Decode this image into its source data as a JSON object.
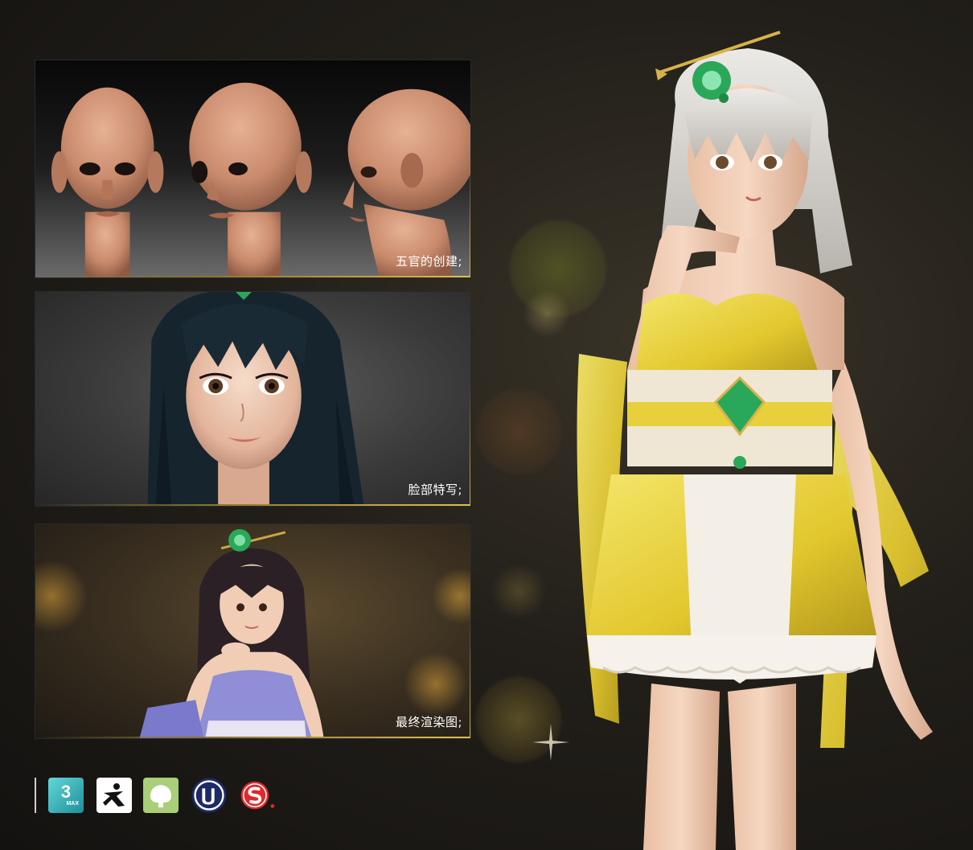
{
  "panels": [
    {
      "caption": "五官的创建;",
      "subject": "head-sculpt-models"
    },
    {
      "caption": "脸部特写;",
      "subject": "face-closeup"
    },
    {
      "caption": "最终渲染图;",
      "subject": "final-render"
    }
  ],
  "software": [
    {
      "name": "3ds-max-icon",
      "number": "3",
      "text": "MAX"
    },
    {
      "name": "zbrush-icon"
    },
    {
      "name": "speedtree-icon"
    },
    {
      "name": "unreal-engine-icon"
    },
    {
      "name": "substance-painter-icon"
    }
  ],
  "colors": {
    "accent_gold": "#d8b548",
    "dress_yellow": "#e8d040",
    "skin": "#f0c9ad",
    "hair_silver": "#d8d5d0",
    "gem_green": "#2aa85a",
    "substance_red": "#e02a2a"
  }
}
